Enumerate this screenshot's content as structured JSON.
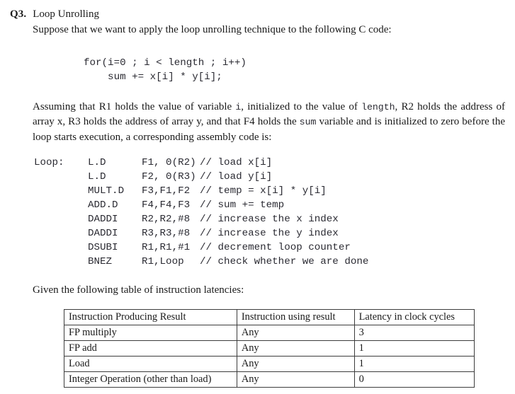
{
  "question": {
    "number": "Q3.",
    "title": "Loop Unrolling",
    "intro": "Suppose that we want to apply the loop unrolling technique to the following C code:"
  },
  "c_code": {
    "line1": "for(i=0 ; i < length ; i++)",
    "line2": "    sum += x[i] * y[i];"
  },
  "assumption": {
    "seg1": "Assuming that R1 holds the value of variable ",
    "mono1": "i",
    "seg2": ", initialized to the value of ",
    "mono2": "length",
    "seg3": ", R2 holds the address of array x, R3 holds the address of array y, and that F4 holds the ",
    "mono3": "sum",
    "seg4": " variable and is initialized to zero before the loop starts execution, a corresponding assembly code is:"
  },
  "assembly": {
    "rows": [
      {
        "label": "Loop:",
        "op": "L.D",
        "args": "F1, 0(R2)",
        "comment": "// load x[i]"
      },
      {
        "label": "",
        "op": "L.D",
        "args": "F2, 0(R3)",
        "comment": "// load y[i]"
      },
      {
        "label": "",
        "op": "MULT.D",
        "args": "F3,F1,F2",
        "comment": "// temp = x[i] * y[i]"
      },
      {
        "label": "",
        "op": "ADD.D",
        "args": "F4,F4,F3",
        "comment": "// sum += temp"
      },
      {
        "label": "",
        "op": "DADDI",
        "args": "R2,R2,#8",
        "comment": "// increase the x index"
      },
      {
        "label": "",
        "op": "DADDI",
        "args": "R3,R3,#8",
        "comment": "// increase the y index"
      },
      {
        "label": "",
        "op": "DSUBI",
        "args": "R1,R1,#1",
        "comment": "// decrement loop counter"
      },
      {
        "label": "",
        "op": "BNEZ",
        "args": "R1,Loop",
        "comment": "// check whether we are done"
      }
    ]
  },
  "table_caption": "Given the following table of instruction latencies:",
  "latency_table": {
    "headers": [
      "Instruction Producing Result",
      "Instruction using result",
      "Latency in clock cycles"
    ],
    "rows": [
      [
        "FP multiply",
        "Any",
        "3"
      ],
      [
        "FP add",
        "Any",
        "1"
      ],
      [
        "Load",
        "Any",
        "1"
      ],
      [
        "Integer Operation (other than load)",
        "Any",
        "0"
      ]
    ]
  }
}
